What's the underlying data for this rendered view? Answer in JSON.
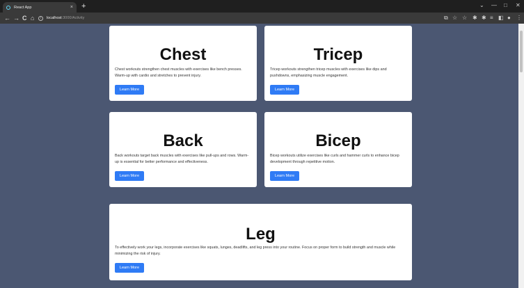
{
  "browser": {
    "tab_title": "React App",
    "tab_close": "×",
    "new_tab": "+",
    "url_host": "localhost",
    "url_path": ":3000/Activity",
    "info_icon": "i",
    "nav": {
      "back": "←",
      "forward": "→",
      "reload": "C",
      "home": "⌂"
    },
    "window": {
      "chevron": "⌄",
      "minimize": "—",
      "maximize": "□",
      "close": "✕"
    },
    "toolbar_icons": {
      "share": "⧉",
      "bookmark": "☆",
      "extension": "✱",
      "media": "≡",
      "sidebar": "◧",
      "profile": "●",
      "menu": "⋮"
    }
  },
  "cards": [
    {
      "title": "Chest",
      "text": "Chest workouts strengthen chest muscles with exercises like bench presses. Warm-up with cardio and stretches to prevent injury.",
      "button": "Learn More"
    },
    {
      "title": "Tricep",
      "text": "Tricep workouts strengthen tricep muscles with exercises like dips and pushdowns, emphasizing muscle engagement.",
      "button": "Learn More"
    },
    {
      "title": "Back",
      "text": "Back workouts target back muscles with exercises like pull-ups and rows. Warm-up is essential for better performance and effectiveness.",
      "button": "Learn More"
    },
    {
      "title": "Bicep",
      "text": "Bicep workouts utilize exercises like curls and hammer curls to enhance bicep development through repetitive motion.",
      "button": "Learn More"
    },
    {
      "title": "Leg",
      "text": "To effectively work your legs, incorporate exercises like squats, lunges, deadlifts, and leg press into your routine. Focus on proper form to build strength and muscle while minimizing the risk of injury.",
      "button": "Learn More"
    }
  ]
}
